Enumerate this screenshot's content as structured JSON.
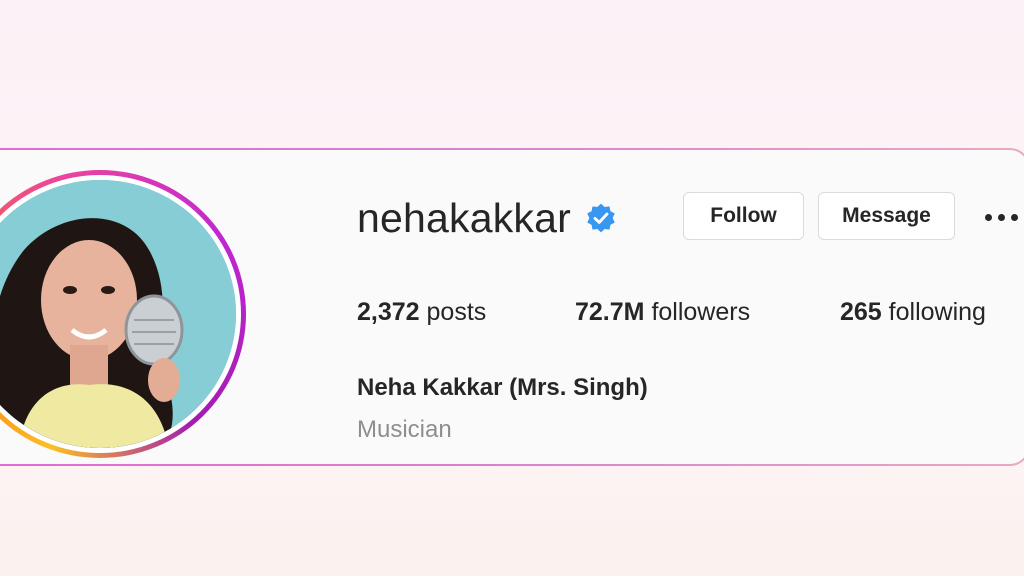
{
  "profile": {
    "username": "nehakakkar",
    "verified": true,
    "full_name": "Neha Kakkar (Mrs. Singh)",
    "category": "Musician"
  },
  "actions": {
    "follow_label": "Follow",
    "message_label": "Message",
    "more_icon": "more-horizontal-icon"
  },
  "stats": {
    "posts_count": "2,372",
    "posts_label": "posts",
    "followers_count": "72.7M",
    "followers_label": "followers",
    "following_count": "265",
    "following_label": "following"
  },
  "colors": {
    "verified_badge": "#3897f0",
    "card_border": "#e36ad1",
    "story_ring": "#c026d3"
  }
}
